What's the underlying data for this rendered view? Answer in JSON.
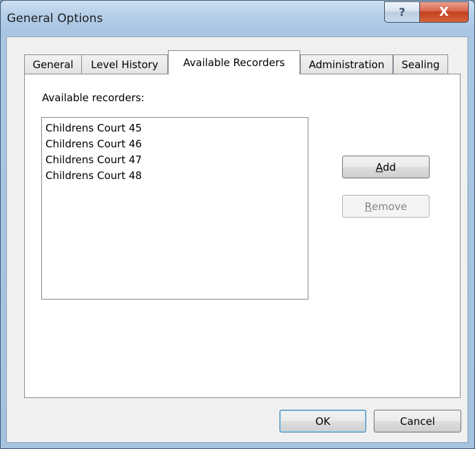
{
  "window": {
    "title": "General Options",
    "help_glyph": "?",
    "close_glyph": "X"
  },
  "tabs": [
    {
      "label": "General"
    },
    {
      "label": "Level History"
    },
    {
      "label": "Available Recorders",
      "active": true
    },
    {
      "label": "Administration"
    },
    {
      "label": "Sealing"
    }
  ],
  "panel": {
    "label": "Available recorders:",
    "recorders": [
      "Childrens Court 45",
      "Childrens Court 46",
      "Childrens Court 47",
      "Childrens Court 48"
    ],
    "add_button": {
      "mnemonic": "A",
      "rest": "dd",
      "enabled": true
    },
    "remove_button": {
      "mnemonic": "R",
      "rest": "emove",
      "enabled": false
    }
  },
  "footer": {
    "ok_label": "OK",
    "cancel_label": "Cancel"
  },
  "icons": {
    "help": "help-icon",
    "close": "close-icon"
  }
}
